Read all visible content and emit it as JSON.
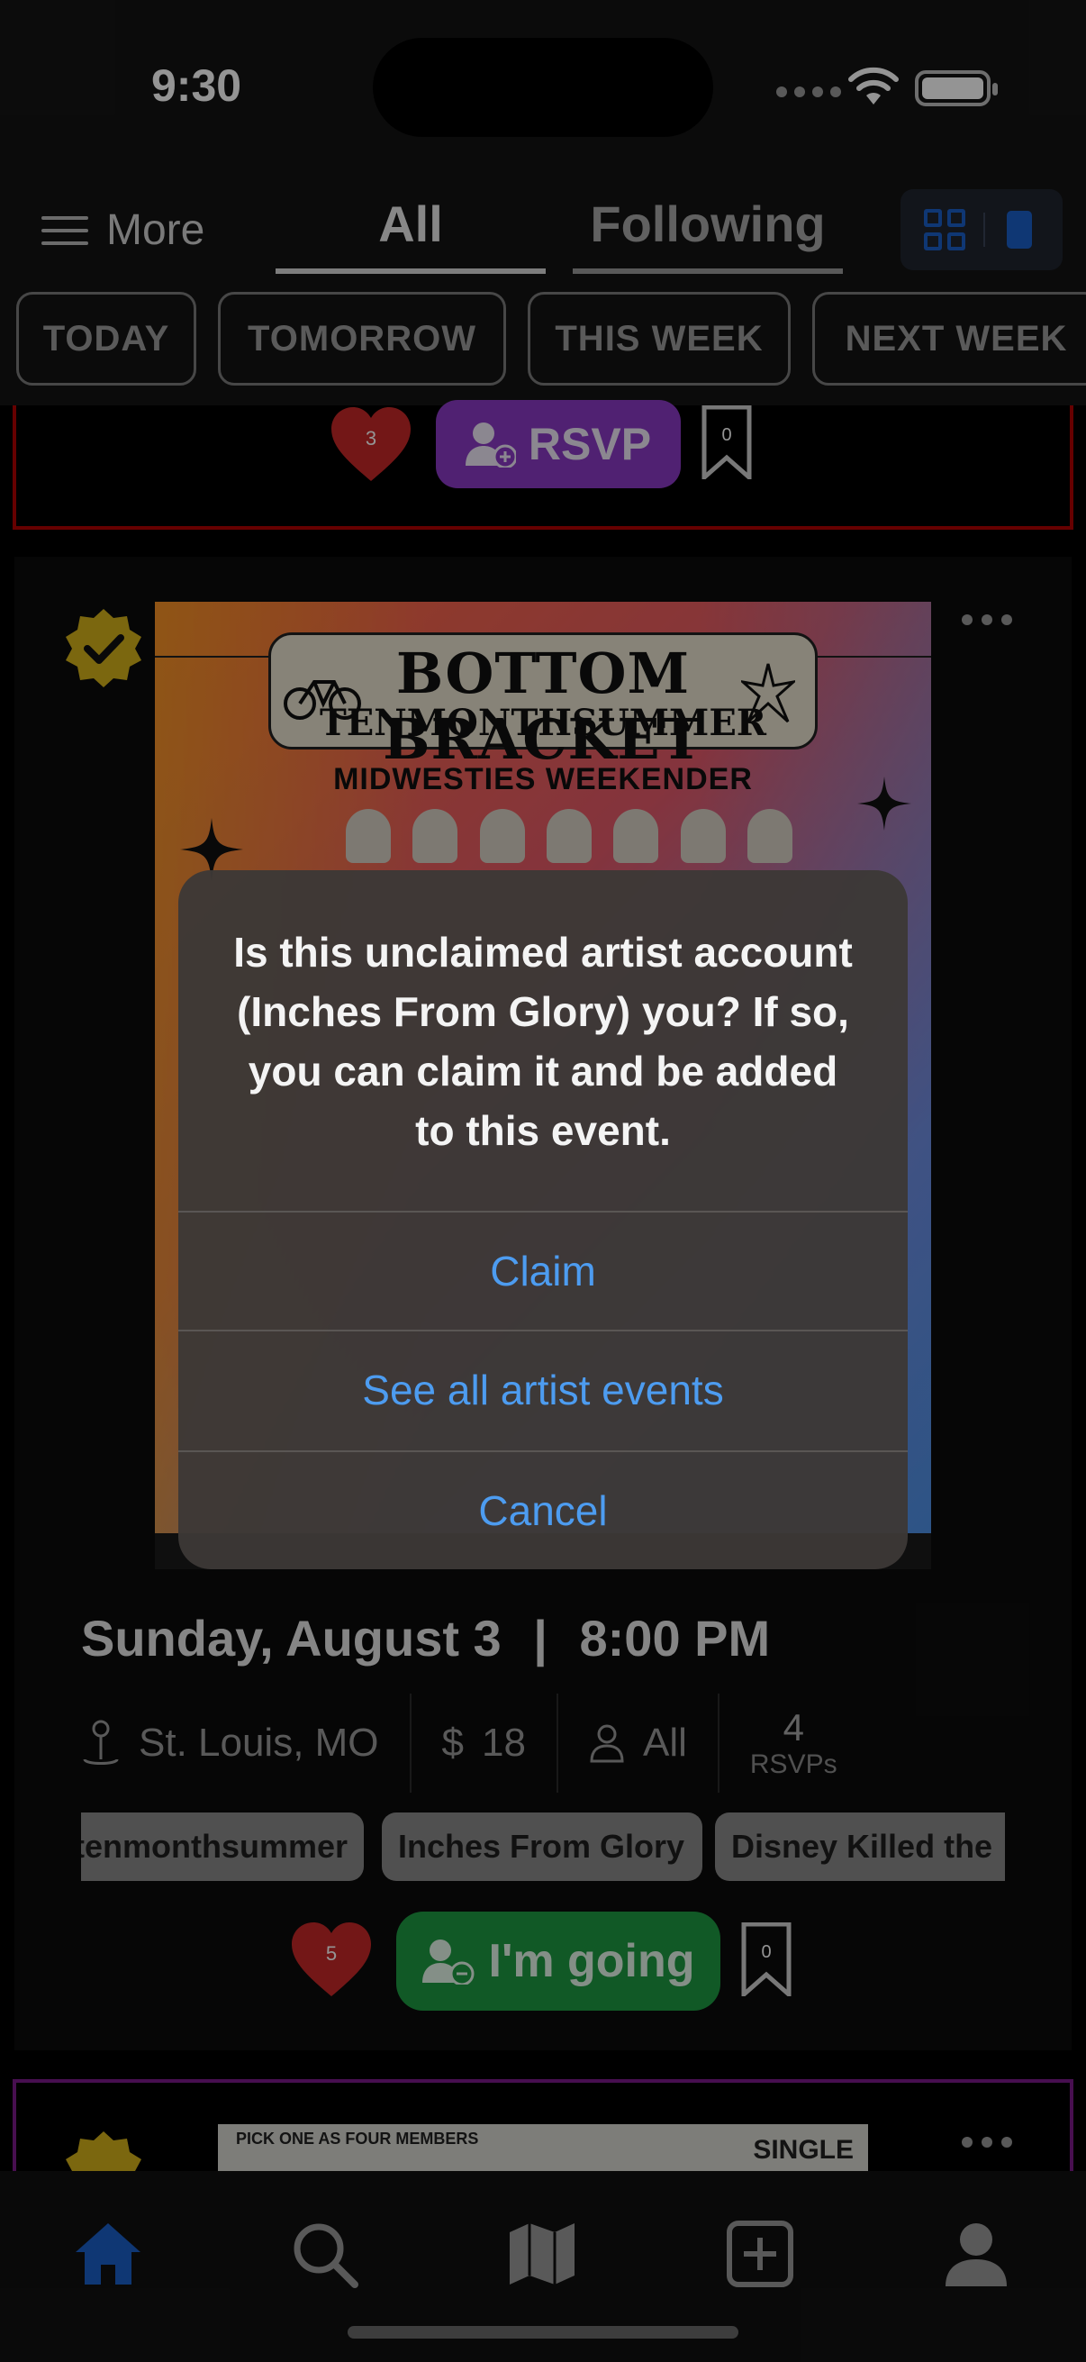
{
  "status_bar": {
    "time": "9:30"
  },
  "top_nav": {
    "menu_label": "More",
    "tabs": [
      {
        "label": "All",
        "active": true
      },
      {
        "label": "Following",
        "active": false
      }
    ]
  },
  "filters": [
    "TODAY",
    "TOMORROW",
    "THIS WEEK",
    "NEXT WEEK"
  ],
  "previous_card": {
    "likes": "3",
    "rsvp_label": "RSVP",
    "bookmarks": "0"
  },
  "event_card": {
    "poster": {
      "title": "BOTTOM BRACKET",
      "subtitle": "TENMONTHSUMMER",
      "tagline": "MIDWESTIES WEEKENDER"
    },
    "date": "Sunday, August 3",
    "separator": "|",
    "time": "8:00 PM",
    "location": "St. Louis, MO",
    "price_symbol": "$",
    "price": "18",
    "age": "All",
    "rsvp_count": "4",
    "rsvp_label": "RSVPs",
    "artists": [
      "tenmonthsummer",
      "Inches From Glory",
      "Disney Killed the"
    ],
    "likes": "5",
    "going_label": "I'm going",
    "bookmarks": "0"
  },
  "next_card": {
    "clip_text": "PICK ONE AS FOUR MEMBERS",
    "clip_single": "SINGLE"
  },
  "alert": {
    "message": "Is this unclaimed artist account (Inches From Glory) you? If so, you can claim it and be added to this event.",
    "buttons": [
      "Claim",
      "See all artist events",
      "Cancel"
    ]
  },
  "tab_bar": [
    "home-icon",
    "search-icon",
    "map-icon",
    "add-icon",
    "profile-icon"
  ],
  "colors": {
    "accent_blue": "#1a5fc8",
    "alert_link": "#4d9cf0",
    "going_green": "#1e9a42",
    "rsvp_purple": "#8a3ac4",
    "heart_red": "#c62828"
  }
}
